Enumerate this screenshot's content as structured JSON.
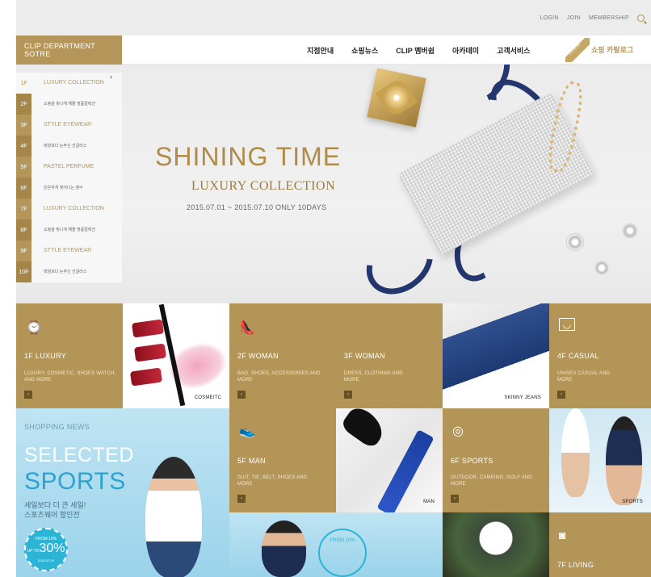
{
  "util": {
    "login": "LOGIN",
    "join": "JOIN",
    "membership": "MEMBERSHIP"
  },
  "header": {
    "logo": "CLIP DEPARTMENT SOTRE",
    "nav": [
      "지점안내",
      "쇼핑뉴스",
      "CLIP 멤버쉽",
      "아카데미",
      "고객서비스"
    ],
    "catalog_tag": "CATALOG",
    "catalog_link": "쇼핑 카탈로그"
  },
  "floors": [
    {
      "floor": "1F",
      "text": "LUXURY COLLECTION"
    },
    {
      "floor": "2F",
      "text": "쇼핑을 빛나게 해줄 명품컬렉션"
    },
    {
      "floor": "3F",
      "text": "STYLE EYEWEAR"
    },
    {
      "floor": "4F",
      "text": "태양보다 눈부신 선글라스"
    },
    {
      "floor": "5F",
      "text": "PASTEL PERFUME"
    },
    {
      "floor": "6F",
      "text": "은은하게 빛어나는 향수"
    },
    {
      "floor": "7F",
      "text": "LUXURY COLLECTION"
    },
    {
      "floor": "8F",
      "text": "쇼핑을 빛나게 해줄 명품컬렉션"
    },
    {
      "floor": "9F",
      "text": "STYLE EYEWEAR"
    },
    {
      "floor": "10F",
      "text": "태양보다 눈부신 선글라스"
    }
  ],
  "hero": {
    "title": "SHINING TIME",
    "subtitle": "LUXURY COLLECTION",
    "date": "2015.07.01 ~ 2015.07.10 ONLY 10DAYS"
  },
  "tiles": {
    "luxury": {
      "title": "1F LUXURY",
      "desc": "LUXURY, COSMETIC, SHOES WATCH, AND MORE"
    },
    "cosmetic": {
      "label": "COSMEITC"
    },
    "woman2": {
      "title": "2F WOMAN",
      "desc": "BAG, SHOES, ACCESSORIES AND MORE"
    },
    "woman3": {
      "title": "3F WOMAN",
      "desc": "DRESS, CLOTHING AND MORE"
    },
    "jeans": {
      "label": "SKINNY JEANS"
    },
    "casual": {
      "title": "4F CASUAL",
      "desc": "UNISEX CASUAL AND MORE"
    },
    "man": {
      "title": "5F MAN",
      "desc": "SUIT, TIE, BELT, SHOES AND MORE"
    },
    "man_photo": {
      "label": "MAN"
    },
    "sports": {
      "title": "6F SPORTS",
      "desc": "OUTDOOR, CAMPING, GOLF AND MORE"
    },
    "sports_photo": {
      "label": "SPORTS"
    },
    "living": {
      "title": "7F LIVING"
    }
  },
  "shopping_news": {
    "label": "SHOPPING NEWS",
    "selected": "SELECTED",
    "sports": "SPORTS",
    "line1": "세일보다 더 큰 세일!",
    "line2": "스포츠웨어 할인전",
    "badge_top": "FROM 10%",
    "badge_up": "UP TO",
    "badge_value": "30%",
    "badge_date": "2015.07.10",
    "badge2": "FROM 10%"
  },
  "colors": {
    "gold": "#b39558",
    "navy_ribbon": "#24366e",
    "sky": "#9ad3ea"
  }
}
